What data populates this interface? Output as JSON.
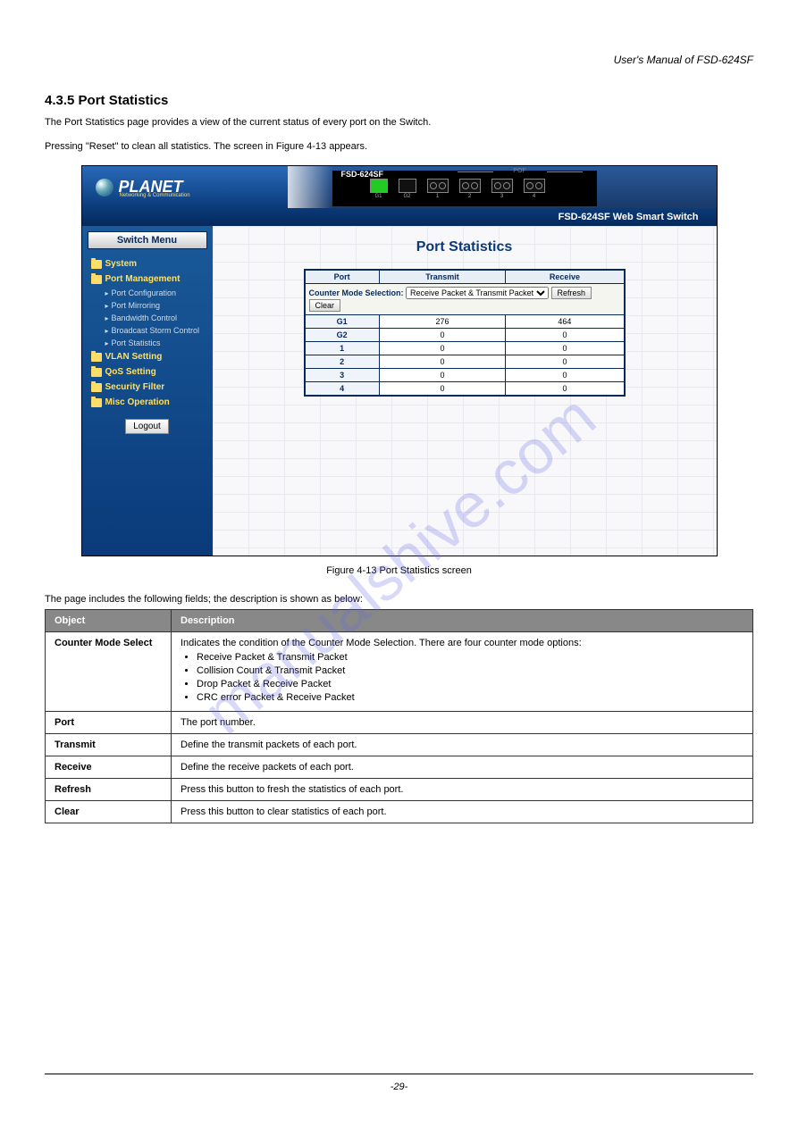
{
  "doc_title": "User's Manual of FSD-624SF",
  "section_number": "4.3.5 Port Statistics",
  "section_desc_1": "The Port Statistics page provides a view of the current status of every port on the Switch.",
  "section_desc_2": "Pressing \"Reset\" to clean all statistics. The screen in Figure 4-13 appears.",
  "watermark": "manualshive.com",
  "screenshot": {
    "logo": "PLANET",
    "logo_sub": "Networking & Communication",
    "model": "FSD-624SF",
    "pof_label": "POF",
    "ports": [
      {
        "label": "G1",
        "type": "green"
      },
      {
        "label": "G2",
        "type": "dark"
      },
      {
        "label": "1",
        "type": "fiber"
      },
      {
        "label": "2",
        "type": "fiber"
      },
      {
        "label": "3",
        "type": "fiber"
      },
      {
        "label": "4",
        "type": "fiber"
      }
    ],
    "subheader": "FSD-624SF Web Smart Switch",
    "menu_title": "Switch Menu",
    "menu": {
      "system": "System",
      "port_mgmt": "Port Management",
      "subs": [
        "Port Configuration",
        "Port Mirroring",
        "Bandwidth Control",
        "Broadcast Storm Control",
        "Port Statistics"
      ],
      "vlan": "VLAN Setting",
      "qos": "QoS Setting",
      "security": "Security Filter",
      "misc": "Misc Operation",
      "logout": "Logout"
    },
    "content": {
      "title": "Port Statistics",
      "counter_label": "Counter Mode Selection:",
      "mode_value": "Receive Packet & Transmit Packet",
      "refresh_btn": "Refresh",
      "clear_btn": "Clear",
      "headers": [
        "Port",
        "Transmit",
        "Receive"
      ],
      "rows": [
        {
          "port": "G1",
          "tx": "276",
          "rx": "464"
        },
        {
          "port": "G2",
          "tx": "0",
          "rx": "0"
        },
        {
          "port": "1",
          "tx": "0",
          "rx": "0"
        },
        {
          "port": "2",
          "tx": "0",
          "rx": "0"
        },
        {
          "port": "3",
          "tx": "0",
          "rx": "0"
        },
        {
          "port": "4",
          "tx": "0",
          "rx": "0"
        }
      ]
    }
  },
  "figure_caption": "Figure 4-13 Port Statistics screen",
  "objects_intro": "The page includes the following fields; the description is shown as below:",
  "obj_headers": [
    "Object",
    "Description"
  ],
  "objects": [
    {
      "obj": "Counter Mode Select",
      "desc": "Indicates the condition of the Counter Mode Selection. There are four counter mode options:",
      "list": [
        "Receive Packet & Transmit Packet",
        "Collision Count & Transmit Packet",
        "Drop Packet & Receive Packet",
        "CRC error Packet & Receive Packet"
      ]
    },
    {
      "obj": "Port",
      "desc": "The port number."
    },
    {
      "obj": "Transmit",
      "desc": "Define the transmit packets of each port."
    },
    {
      "obj": "Receive",
      "desc": "Define the receive packets of each port."
    },
    {
      "obj": "Refresh",
      "desc": "Press this button to fresh the statistics of each port."
    },
    {
      "obj": "Clear",
      "desc": "Press this button to clear statistics of each port."
    }
  ],
  "page_number": "-29-"
}
